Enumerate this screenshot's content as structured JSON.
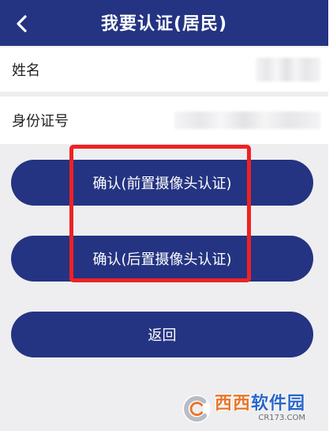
{
  "navbar": {
    "title": "我要认证(居民)",
    "back_icon": "chevron-left-icon"
  },
  "form": {
    "name_label": "姓名",
    "id_label": "身份证号"
  },
  "buttons": {
    "front_camera": "确认(前置摄像头认证)",
    "rear_camera": "确认(后置摄像头认证)",
    "return": "返回"
  },
  "watermark": {
    "main": "西西",
    "main_accent": "软件园",
    "sub": "CR173.COM"
  },
  "colors": {
    "brand": "#243482",
    "highlight": "#ee2222"
  }
}
